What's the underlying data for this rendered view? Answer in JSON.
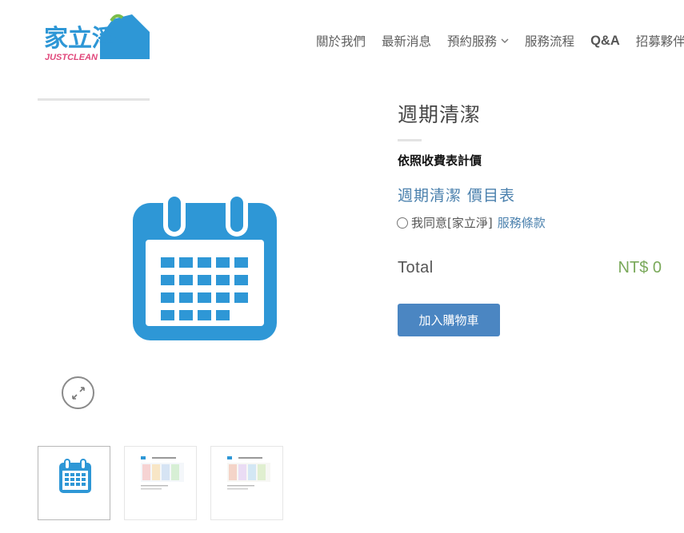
{
  "logo": {
    "main_text": "家立淨",
    "sub_text": "JUSTCLEAN"
  },
  "nav": {
    "items": [
      "關於我們",
      "最新消息",
      "預約服務",
      "服務流程",
      "Q&A",
      "招募夥伴"
    ]
  },
  "product": {
    "title": "週期清潔",
    "price_note": "依照收費表計價",
    "price_table_link": "週期清潔 價目表",
    "agree_text": "我同意[家立淨]",
    "terms_link": "服務條款",
    "total_label": "Total",
    "total_value": "NT$ 0",
    "add_to_cart": "加入購物車"
  },
  "colors": {
    "accent_blue": "#4a80ad",
    "button_blue": "#4b86c2",
    "calendar_blue": "#2e97d6",
    "price_green": "#7aa95a"
  },
  "icons": {
    "main_image": "calendar-icon",
    "zoom": "expand-icon",
    "nav_dropdown": "chevron-down-icon"
  }
}
